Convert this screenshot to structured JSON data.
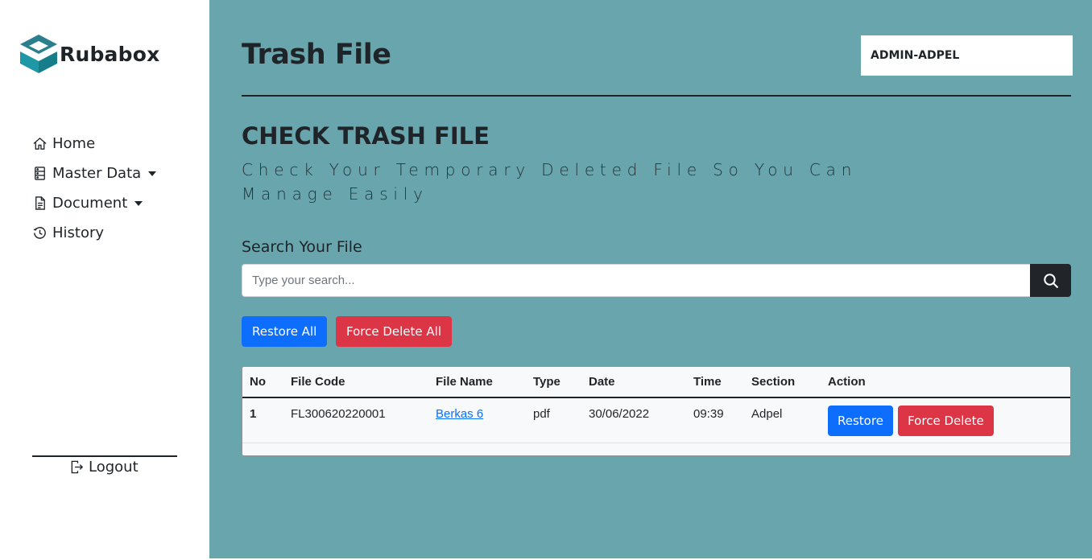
{
  "sidebar": {
    "brand": "Rubabox",
    "items": [
      {
        "label": "Home",
        "icon": "home-icon"
      },
      {
        "label": "Master Data",
        "icon": "database-icon",
        "dropdown": true
      },
      {
        "label": "Document",
        "icon": "document-icon",
        "dropdown": true
      },
      {
        "label": "History",
        "icon": "history-icon"
      }
    ],
    "logout_label": "Logout"
  },
  "header": {
    "title": "Trash File",
    "user": "ADMIN-ADPEL"
  },
  "section": {
    "title": "CHECK TRASH FILE",
    "subtitle": "Check Your Temporary Deleted File So You Can Manage Easily"
  },
  "search": {
    "label": "Search Your File",
    "placeholder": "Type your search...",
    "value": ""
  },
  "actions": {
    "restore_all": "Restore All",
    "force_delete_all": "Force Delete All"
  },
  "table": {
    "columns": [
      "No",
      "File Code",
      "File Name",
      "Type",
      "Date",
      "Time",
      "Section",
      "Action"
    ],
    "rows": [
      {
        "no": "1",
        "file_code": "FL300620220001",
        "file_name": "Berkas 6",
        "type": "pdf",
        "date": "30/06/2022",
        "time": "09:39",
        "section": "Adpel",
        "restore_label": "Restore",
        "force_delete_label": "Force Delete"
      }
    ]
  },
  "colors": {
    "main_bg": "#69a5ad",
    "primary": "#0d6efd",
    "danger": "#dc3545",
    "dark": "#212529",
    "logo_teal": "#1e98a6"
  }
}
